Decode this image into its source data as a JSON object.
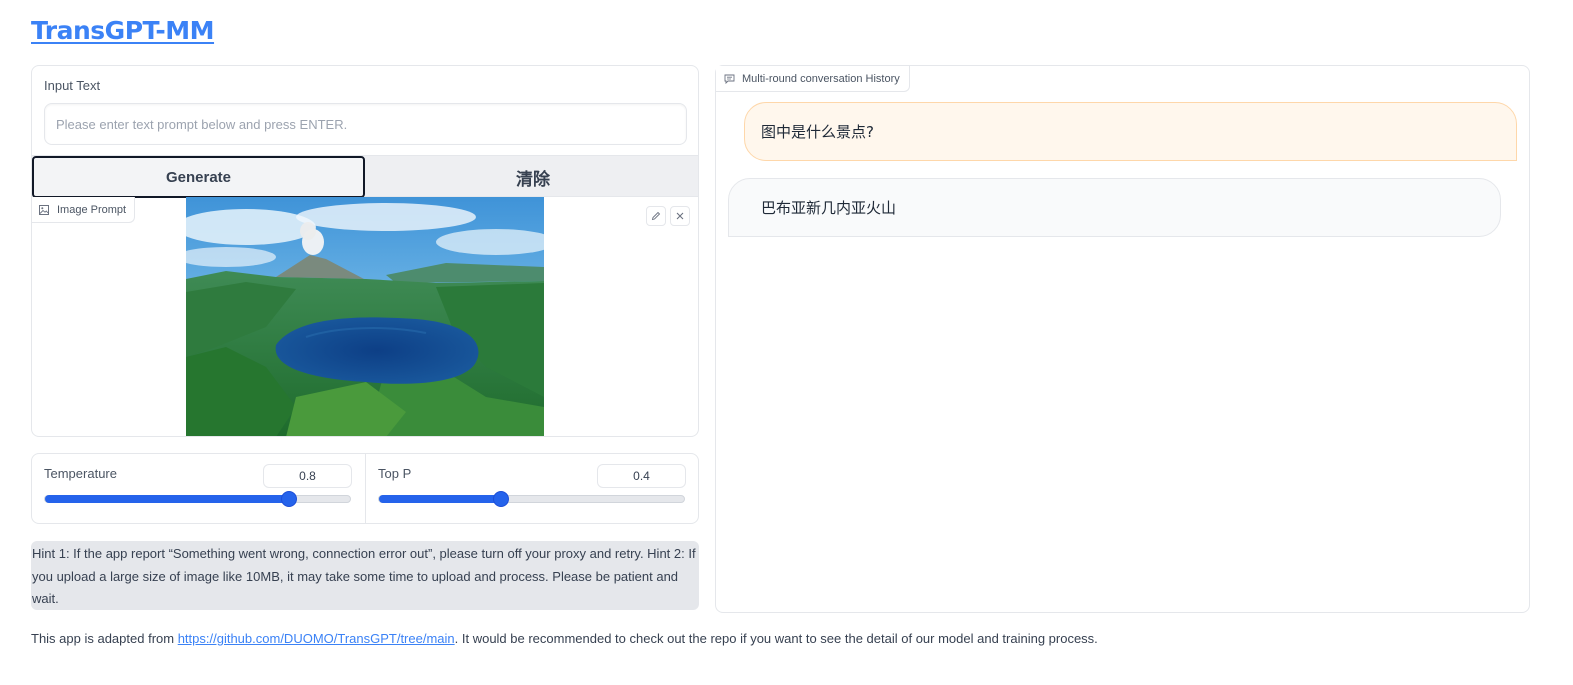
{
  "app": {
    "title": "TransGPT-MM"
  },
  "input": {
    "label": "Input Text",
    "placeholder": "Please enter text prompt below and press ENTER.",
    "value": ""
  },
  "buttons": {
    "generate": "Generate",
    "clear": "清除"
  },
  "image_prompt": {
    "label": "Image Prompt",
    "icon": "image-icon",
    "edit_icon": "pencil-icon",
    "close_icon": "close-icon"
  },
  "sliders": {
    "temperature": {
      "label": "Temperature",
      "value": "0.8",
      "fraction": 0.8
    },
    "top_p": {
      "label": "Top P",
      "value": "0.4",
      "fraction": 0.4
    }
  },
  "hint": "Hint 1: If the app report “Something went wrong, connection error out”, please turn off your proxy and retry. Hint 2: If you upload a large size of image like 10MB, it may take some time to upload and process. Please be patient and wait.",
  "chat": {
    "label": "Multi-round conversation History",
    "icon": "chat-icon",
    "messages": [
      {
        "role": "user",
        "text": "图中是什么景点?"
      },
      {
        "role": "bot",
        "text": "巴布亚新几内亚火山"
      }
    ]
  },
  "footer": {
    "prefix": "This app is adapted from ",
    "link": "https://github.com/DUOMO/TransGPT/tree/main",
    "suffix": ". It would be recommended to check out the repo if you want to see the detail of our model and training process."
  },
  "colors": {
    "accent": "#2563eb",
    "link": "#3b82f6",
    "user_bubble": "#fff7ed",
    "bot_bubble": "#f9fafb"
  }
}
